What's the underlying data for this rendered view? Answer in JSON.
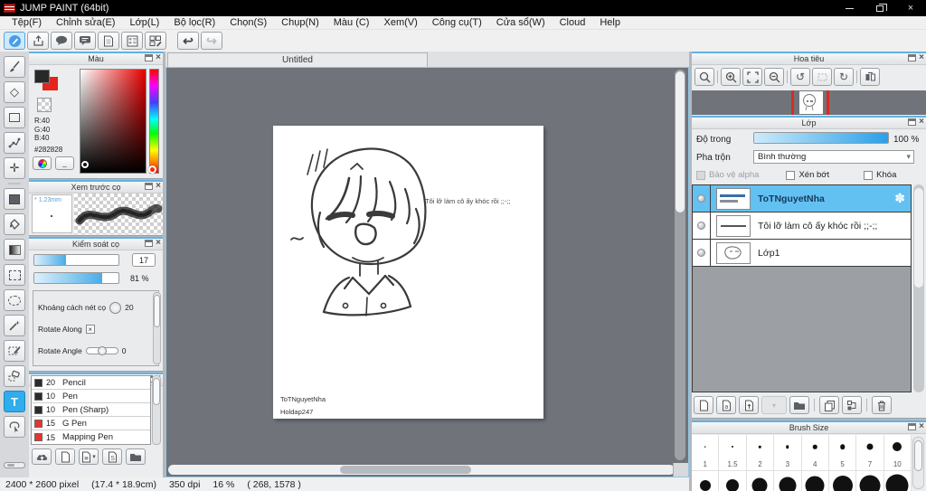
{
  "window": {
    "title": "JUMP PAINT (64bit)"
  },
  "icons": {
    "close": "×",
    "undo": "↩",
    "redo": "↪",
    "rotate_ccw": "↺",
    "rotate_cw": "↻",
    "gear": "✽",
    "move": "✛",
    "eraser": "◇",
    "dropdown_arrow": "▾",
    "swatch_extra": "_",
    "magic_wand": "✶",
    "text_tool": "T",
    "check": "×"
  },
  "menu": {
    "items": [
      "Tệp(F)",
      "Chỉnh sửa(E)",
      "Lớp(L)",
      "Bộ lọc(R)",
      "Chọn(S)",
      "Chụp(N)",
      "Màu (C)",
      "Xem(V)",
      "Công cụ(T)",
      "Cửa sổ(W)",
      "Cloud",
      "Help"
    ]
  },
  "panels": {
    "color": {
      "title": "Màu",
      "r_label": "R:40",
      "g_label": "G:40",
      "b_label": "B:40",
      "hex": "#282828",
      "foreground": "#282828",
      "background": "#e3251c"
    },
    "brush_preview": {
      "title": "Xem trước cọ",
      "size_label": "1.23mm"
    },
    "brush_control": {
      "title": "Kiểm soát cọ",
      "size_value": "17",
      "opacity_value": "81 %",
      "spacing_label": "Khoảng cách nét cọ",
      "spacing_value": "20",
      "rotate_along_label": "Rotate Along",
      "rotate_angle_label": "Rotate Angle",
      "rotate_angle_value": "0"
    },
    "brushes": {
      "title": "Cọ",
      "items": [
        {
          "size": "20",
          "name": "Pencil",
          "color": "#2b2b2b"
        },
        {
          "size": "10",
          "name": "Pen",
          "color": "#2b2b2b"
        },
        {
          "size": "10",
          "name": "Pen (Sharp)",
          "color": "#2b2b2b"
        },
        {
          "size": "15",
          "name": "G Pen",
          "color": "#e8352c"
        },
        {
          "size": "15",
          "name": "Mapping Pen",
          "color": "#e8352c"
        }
      ]
    },
    "navigator": {
      "title": "Hoa tiêu"
    },
    "layers": {
      "title": "Lớp",
      "opacity_label": "Độ trong",
      "opacity_value": "100 %",
      "blend_label": "Pha trộn",
      "blend_value": "Bình thường",
      "alpha_label": "Bảo vệ alpha",
      "clip_label": "Xén bớt",
      "lock_label": "Khóa",
      "items": [
        {
          "name": "ToTNguyetNha",
          "selected": true
        },
        {
          "name": "Tôi lỡ làm cô ấy khóc rồi ;;-;;",
          "selected": false
        },
        {
          "name": "Lớp1",
          "selected": false
        }
      ]
    },
    "brush_size": {
      "title": "Brush Size",
      "sizes": [
        "1",
        "1.5",
        "2",
        "3",
        "4",
        "5",
        "7",
        "10"
      ]
    }
  },
  "canvas": {
    "tab": "Untitled",
    "caption": "Tôi lỡ làm cô ấy khóc rồi ;;-;;",
    "credit1": "ToTNguyetNha",
    "credit2": "Holdap247"
  },
  "status": {
    "size": "2400 * 2600 pixel",
    "dimensions": "(17.4 * 18.9cm)",
    "dpi": "350 dpi",
    "zoom": "16 %",
    "coords": "( 268, 1578 )"
  },
  "colors": {
    "accent_blue": "#2fadec",
    "selected_layer": "#63c1f2",
    "canvas_bg": "#70747a"
  }
}
